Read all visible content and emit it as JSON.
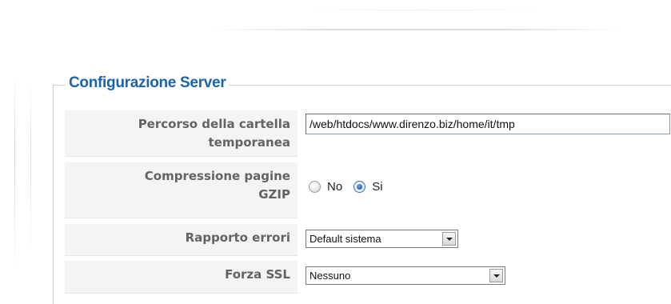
{
  "section": {
    "title": "Configurazione Server"
  },
  "fields": {
    "temp_folder": {
      "label_line1": "Percorso della cartella",
      "label_line2": "temporanea",
      "value": "/web/htdocs/www.direnzo.biz/home/it/tmp"
    },
    "gzip": {
      "label_line1": "Compressione pagine",
      "label_line2": "GZIP",
      "options": [
        {
          "label": "No",
          "checked": false
        },
        {
          "label": "Si",
          "checked": true
        }
      ]
    },
    "error_reporting": {
      "label": "Rapporto errori",
      "selected": "Default sistema"
    },
    "force_ssl": {
      "label": "Forza SSL",
      "selected": "Nessuno"
    }
  },
  "colors": {
    "legend": "#1b64a8",
    "label_text": "#636363",
    "label_bg": "#f4f4f4"
  }
}
